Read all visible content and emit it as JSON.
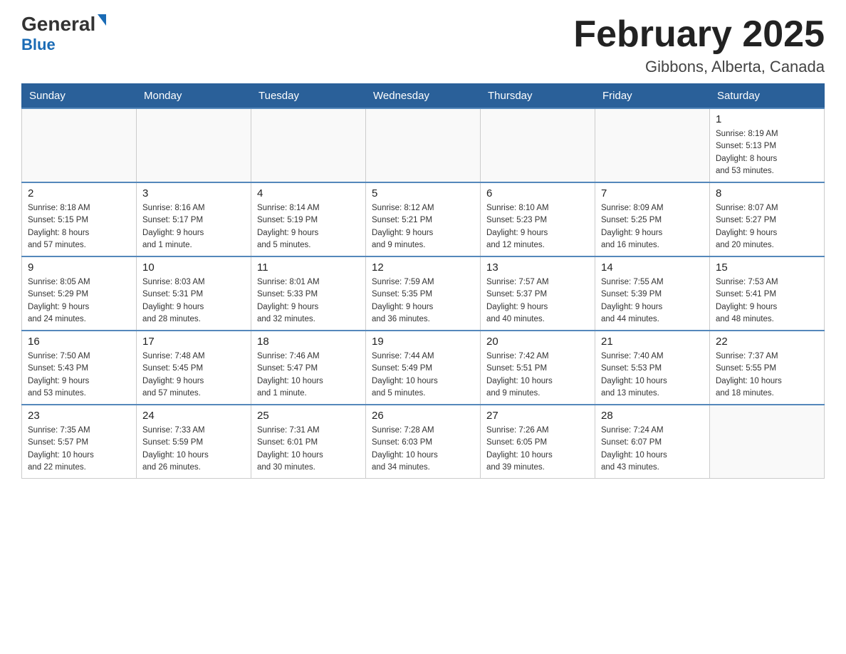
{
  "header": {
    "logo_main": "General",
    "logo_sub": "Blue",
    "month_title": "February 2025",
    "location": "Gibbons, Alberta, Canada"
  },
  "days_of_week": [
    "Sunday",
    "Monday",
    "Tuesday",
    "Wednesday",
    "Thursday",
    "Friday",
    "Saturday"
  ],
  "weeks": [
    [
      {
        "day": "",
        "info": ""
      },
      {
        "day": "",
        "info": ""
      },
      {
        "day": "",
        "info": ""
      },
      {
        "day": "",
        "info": ""
      },
      {
        "day": "",
        "info": ""
      },
      {
        "day": "",
        "info": ""
      },
      {
        "day": "1",
        "info": "Sunrise: 8:19 AM\nSunset: 5:13 PM\nDaylight: 8 hours\nand 53 minutes."
      }
    ],
    [
      {
        "day": "2",
        "info": "Sunrise: 8:18 AM\nSunset: 5:15 PM\nDaylight: 8 hours\nand 57 minutes."
      },
      {
        "day": "3",
        "info": "Sunrise: 8:16 AM\nSunset: 5:17 PM\nDaylight: 9 hours\nand 1 minute."
      },
      {
        "day": "4",
        "info": "Sunrise: 8:14 AM\nSunset: 5:19 PM\nDaylight: 9 hours\nand 5 minutes."
      },
      {
        "day": "5",
        "info": "Sunrise: 8:12 AM\nSunset: 5:21 PM\nDaylight: 9 hours\nand 9 minutes."
      },
      {
        "day": "6",
        "info": "Sunrise: 8:10 AM\nSunset: 5:23 PM\nDaylight: 9 hours\nand 12 minutes."
      },
      {
        "day": "7",
        "info": "Sunrise: 8:09 AM\nSunset: 5:25 PM\nDaylight: 9 hours\nand 16 minutes."
      },
      {
        "day": "8",
        "info": "Sunrise: 8:07 AM\nSunset: 5:27 PM\nDaylight: 9 hours\nand 20 minutes."
      }
    ],
    [
      {
        "day": "9",
        "info": "Sunrise: 8:05 AM\nSunset: 5:29 PM\nDaylight: 9 hours\nand 24 minutes."
      },
      {
        "day": "10",
        "info": "Sunrise: 8:03 AM\nSunset: 5:31 PM\nDaylight: 9 hours\nand 28 minutes."
      },
      {
        "day": "11",
        "info": "Sunrise: 8:01 AM\nSunset: 5:33 PM\nDaylight: 9 hours\nand 32 minutes."
      },
      {
        "day": "12",
        "info": "Sunrise: 7:59 AM\nSunset: 5:35 PM\nDaylight: 9 hours\nand 36 minutes."
      },
      {
        "day": "13",
        "info": "Sunrise: 7:57 AM\nSunset: 5:37 PM\nDaylight: 9 hours\nand 40 minutes."
      },
      {
        "day": "14",
        "info": "Sunrise: 7:55 AM\nSunset: 5:39 PM\nDaylight: 9 hours\nand 44 minutes."
      },
      {
        "day": "15",
        "info": "Sunrise: 7:53 AM\nSunset: 5:41 PM\nDaylight: 9 hours\nand 48 minutes."
      }
    ],
    [
      {
        "day": "16",
        "info": "Sunrise: 7:50 AM\nSunset: 5:43 PM\nDaylight: 9 hours\nand 53 minutes."
      },
      {
        "day": "17",
        "info": "Sunrise: 7:48 AM\nSunset: 5:45 PM\nDaylight: 9 hours\nand 57 minutes."
      },
      {
        "day": "18",
        "info": "Sunrise: 7:46 AM\nSunset: 5:47 PM\nDaylight: 10 hours\nand 1 minute."
      },
      {
        "day": "19",
        "info": "Sunrise: 7:44 AM\nSunset: 5:49 PM\nDaylight: 10 hours\nand 5 minutes."
      },
      {
        "day": "20",
        "info": "Sunrise: 7:42 AM\nSunset: 5:51 PM\nDaylight: 10 hours\nand 9 minutes."
      },
      {
        "day": "21",
        "info": "Sunrise: 7:40 AM\nSunset: 5:53 PM\nDaylight: 10 hours\nand 13 minutes."
      },
      {
        "day": "22",
        "info": "Sunrise: 7:37 AM\nSunset: 5:55 PM\nDaylight: 10 hours\nand 18 minutes."
      }
    ],
    [
      {
        "day": "23",
        "info": "Sunrise: 7:35 AM\nSunset: 5:57 PM\nDaylight: 10 hours\nand 22 minutes."
      },
      {
        "day": "24",
        "info": "Sunrise: 7:33 AM\nSunset: 5:59 PM\nDaylight: 10 hours\nand 26 minutes."
      },
      {
        "day": "25",
        "info": "Sunrise: 7:31 AM\nSunset: 6:01 PM\nDaylight: 10 hours\nand 30 minutes."
      },
      {
        "day": "26",
        "info": "Sunrise: 7:28 AM\nSunset: 6:03 PM\nDaylight: 10 hours\nand 34 minutes."
      },
      {
        "day": "27",
        "info": "Sunrise: 7:26 AM\nSunset: 6:05 PM\nDaylight: 10 hours\nand 39 minutes."
      },
      {
        "day": "28",
        "info": "Sunrise: 7:24 AM\nSunset: 6:07 PM\nDaylight: 10 hours\nand 43 minutes."
      },
      {
        "day": "",
        "info": ""
      }
    ]
  ]
}
